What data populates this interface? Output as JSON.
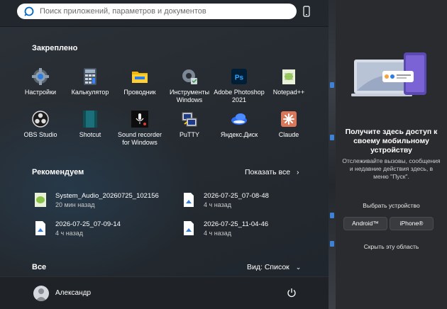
{
  "search": {
    "placeholder": "Поиск приложений, параметров и документов"
  },
  "pinned": {
    "title": "Закреплено",
    "apps": [
      {
        "label": "Настройки",
        "icon": "settings-gear-icon"
      },
      {
        "label": "Калькулятор",
        "icon": "calculator-icon"
      },
      {
        "label": "Проводник",
        "icon": "folder-icon"
      },
      {
        "label": "Инструменты Windows",
        "icon": "windows-tools-icon"
      },
      {
        "label": "Adobe Photoshop 2021",
        "icon": "photoshop-icon"
      },
      {
        "label": "Notepad++",
        "icon": "notepadpp-icon"
      },
      {
        "label": "OBS Studio",
        "icon": "obs-icon"
      },
      {
        "label": "Shotcut",
        "icon": "shotcut-icon"
      },
      {
        "label": "Sound recorder for Windows",
        "icon": "sound-recorder-icon"
      },
      {
        "label": "PuTTY",
        "icon": "putty-icon"
      },
      {
        "label": "Яндекс.Диск",
        "icon": "yandex-disk-icon"
      },
      {
        "label": "Claude",
        "icon": "claude-icon"
      }
    ]
  },
  "recommended": {
    "title": "Рекомендуем",
    "show_all": "Показать все",
    "items": [
      {
        "name": "System_Audio_20260725_102156",
        "time": "20 мин назад"
      },
      {
        "name": "2026-07-25_07-08-48",
        "time": "4 ч назад"
      },
      {
        "name": "2026-07-25_07-09-14",
        "time": "4 ч назад"
      },
      {
        "name": "2026-07-25_11-04-46",
        "time": "4 ч назад"
      }
    ]
  },
  "all": {
    "title": "Все",
    "view": "Вид: Список"
  },
  "user": {
    "name": "Александр"
  },
  "phone_panel": {
    "title": "Получите здесь доступ к своему мобильному устройству",
    "description": "Отслеживайте вызовы, сообщения и недавние действия здесь, в меню \"Пуск\".",
    "choose_device": "Выбрать устройство",
    "android": "Android™",
    "iphone": "iPhone®",
    "hide": "Скрыть эту область"
  },
  "colors": {
    "accent": "#0078d4",
    "start_bg": "#262b31",
    "panel_bg": "#2a2b2e"
  }
}
